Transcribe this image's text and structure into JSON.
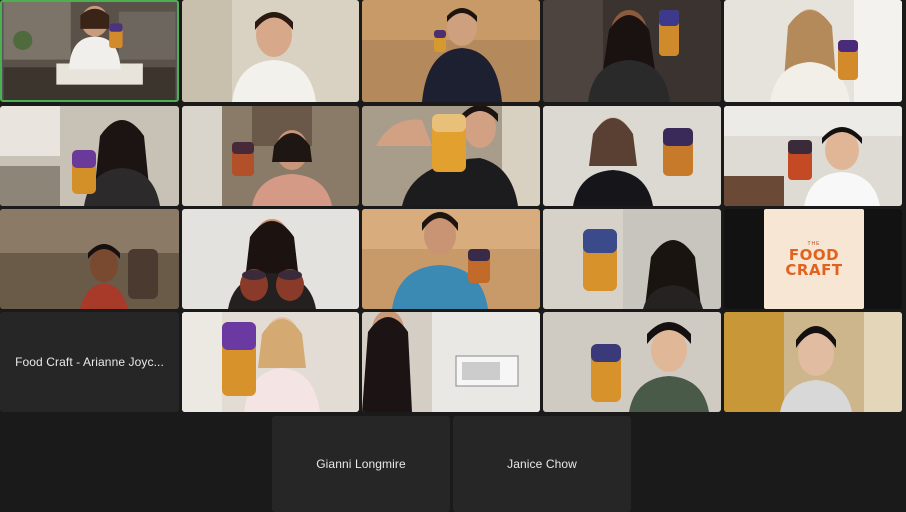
{
  "meeting": {
    "name_tiles": [
      {
        "name": "Food Craft - Arianne Joyc..."
      },
      {
        "name": "Gianni Longmire"
      },
      {
        "name": "Janice Chow"
      }
    ],
    "logo": {
      "small_text": "THE",
      "line1": "FOOD",
      "line2": "CRAFT"
    }
  },
  "colors": {
    "active_speaker_border": "#4caf50",
    "tile_background": "#262626",
    "app_background": "#1a1a1a",
    "logo_orange": "#e0621e",
    "logo_card": "#f7e6d3"
  }
}
